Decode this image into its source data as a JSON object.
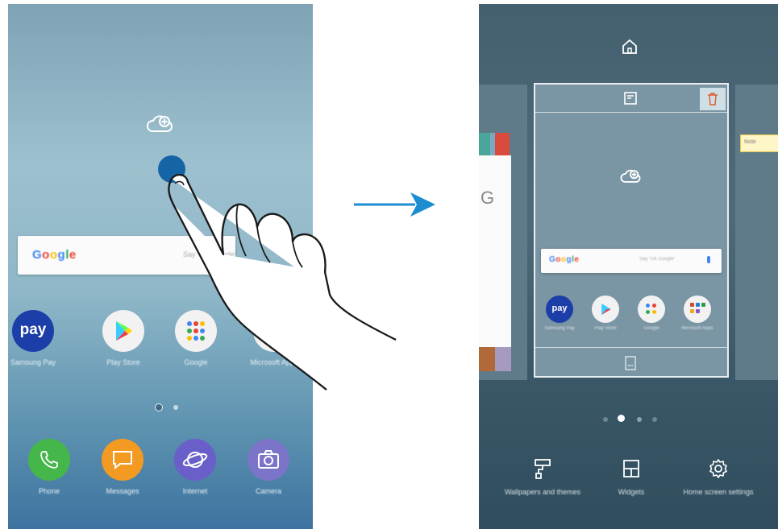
{
  "left_screen": {
    "search_bar": {
      "logo": "Google",
      "hint": "Say “Ok Google”"
    },
    "apps": [
      {
        "label": "Samsung Pay",
        "icon": "samsung-pay-icon",
        "glyph": "pay"
      },
      {
        "label": "Play Store",
        "icon": "play-store-icon"
      },
      {
        "label": "Google",
        "icon": "google-folder-icon"
      },
      {
        "label": "Microsoft Apps",
        "icon": "microsoft-apps-icon"
      }
    ],
    "dock": [
      {
        "label": "Phone",
        "icon": "phone-icon",
        "color": "#45b649"
      },
      {
        "label": "Messages",
        "icon": "messages-icon",
        "color": "#f39a23"
      },
      {
        "label": "Internet",
        "icon": "internet-icon",
        "color": "#6a5fc9"
      },
      {
        "label": "Camera",
        "icon": "camera-icon",
        "color": "#7b74c9"
      }
    ]
  },
  "right_screen": {
    "search_bar": {
      "logo": "Google",
      "hint": "Say “Ok Google”"
    },
    "apps": [
      {
        "label": "Samsung Pay",
        "glyph": "pay"
      },
      {
        "label": "Play Store"
      },
      {
        "label": "Google"
      },
      {
        "label": "Microsoft Apps"
      }
    ],
    "side_widget_text": "Note",
    "side_page_letter": "G",
    "toolbar": [
      {
        "label": "Wallpapers and themes",
        "icon": "paint-roller-icon"
      },
      {
        "label": "Widgets",
        "icon": "widgets-icon"
      },
      {
        "label": "Home screen settings",
        "icon": "gear-icon"
      }
    ]
  }
}
